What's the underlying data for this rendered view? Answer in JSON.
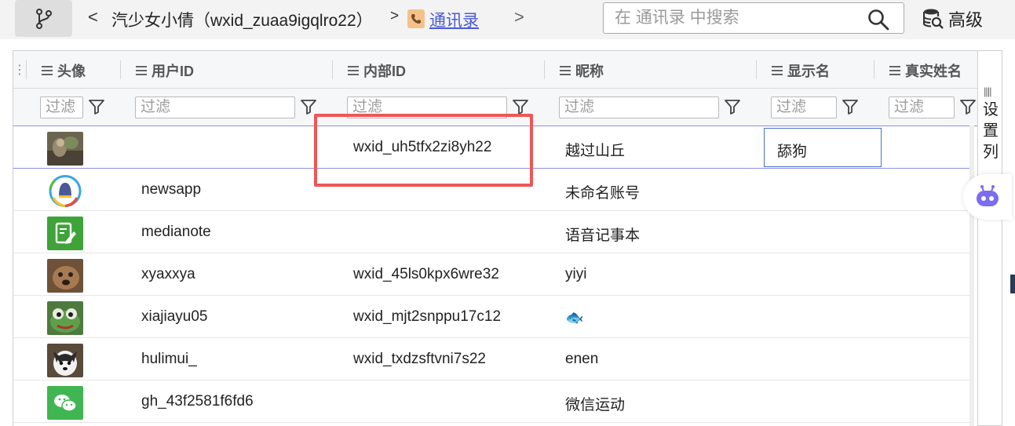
{
  "toolbar": {
    "branch_icon": "branch-icon",
    "back": "<",
    "user_title": "汽少女小倩（wxid_zuaa9igqlro22）",
    "separator": ">",
    "contacts_icon": "phone-book-icon",
    "contacts_label": "通讯录",
    "forward": ">",
    "search_placeholder": "在 通讯录 中搜索",
    "advanced_label": "高级"
  },
  "grid": {
    "columns": [
      {
        "label": "头像"
      },
      {
        "label": "用户ID"
      },
      {
        "label": "内部ID"
      },
      {
        "label": "昵称"
      },
      {
        "label": "显示名"
      },
      {
        "label": "真实姓名"
      }
    ],
    "filter_placeholder": "过滤",
    "rows": [
      {
        "avatar": "cat-photo",
        "user_id": "",
        "internal_id": "wxid_uh5tfx2zi8yh22",
        "nickname": "越过山丘",
        "display_name": "舔狗",
        "selected": true
      },
      {
        "avatar": "newsapp-logo",
        "user_id": "newsapp",
        "internal_id": "",
        "nickname": "未命名账号",
        "display_name": ""
      },
      {
        "avatar": "medianote-logo",
        "user_id": "medianote",
        "internal_id": "",
        "nickname": "语音记事本",
        "display_name": ""
      },
      {
        "avatar": "dog-photo",
        "user_id": "xyaxxya",
        "internal_id": "wxid_45ls0kpx6wre32",
        "nickname": "yiyi",
        "display_name": ""
      },
      {
        "avatar": "frog-photo",
        "user_id": "xiajiayu05",
        "internal_id": "wxid_mjt2snppu17c12",
        "nickname": "🐟",
        "display_name": ""
      },
      {
        "avatar": "husky-photo",
        "user_id": "hulimui_",
        "internal_id": "wxid_txdzsftvni7s22",
        "nickname": "enen",
        "display_name": ""
      },
      {
        "avatar": "wechat-logo",
        "user_id": "gh_43f2581f6fd6",
        "internal_id": "",
        "nickname": "微信运动",
        "display_name": ""
      }
    ]
  },
  "side_panel": {
    "label": "设置列",
    "grip_icon": "grip-icon"
  },
  "assistant_icon": "robot-icon",
  "colors": {
    "accent": "#4a5bd0",
    "highlight": "#ef5656",
    "selection_line": "#8c8fe0",
    "assistant": "#7b6cf0"
  }
}
